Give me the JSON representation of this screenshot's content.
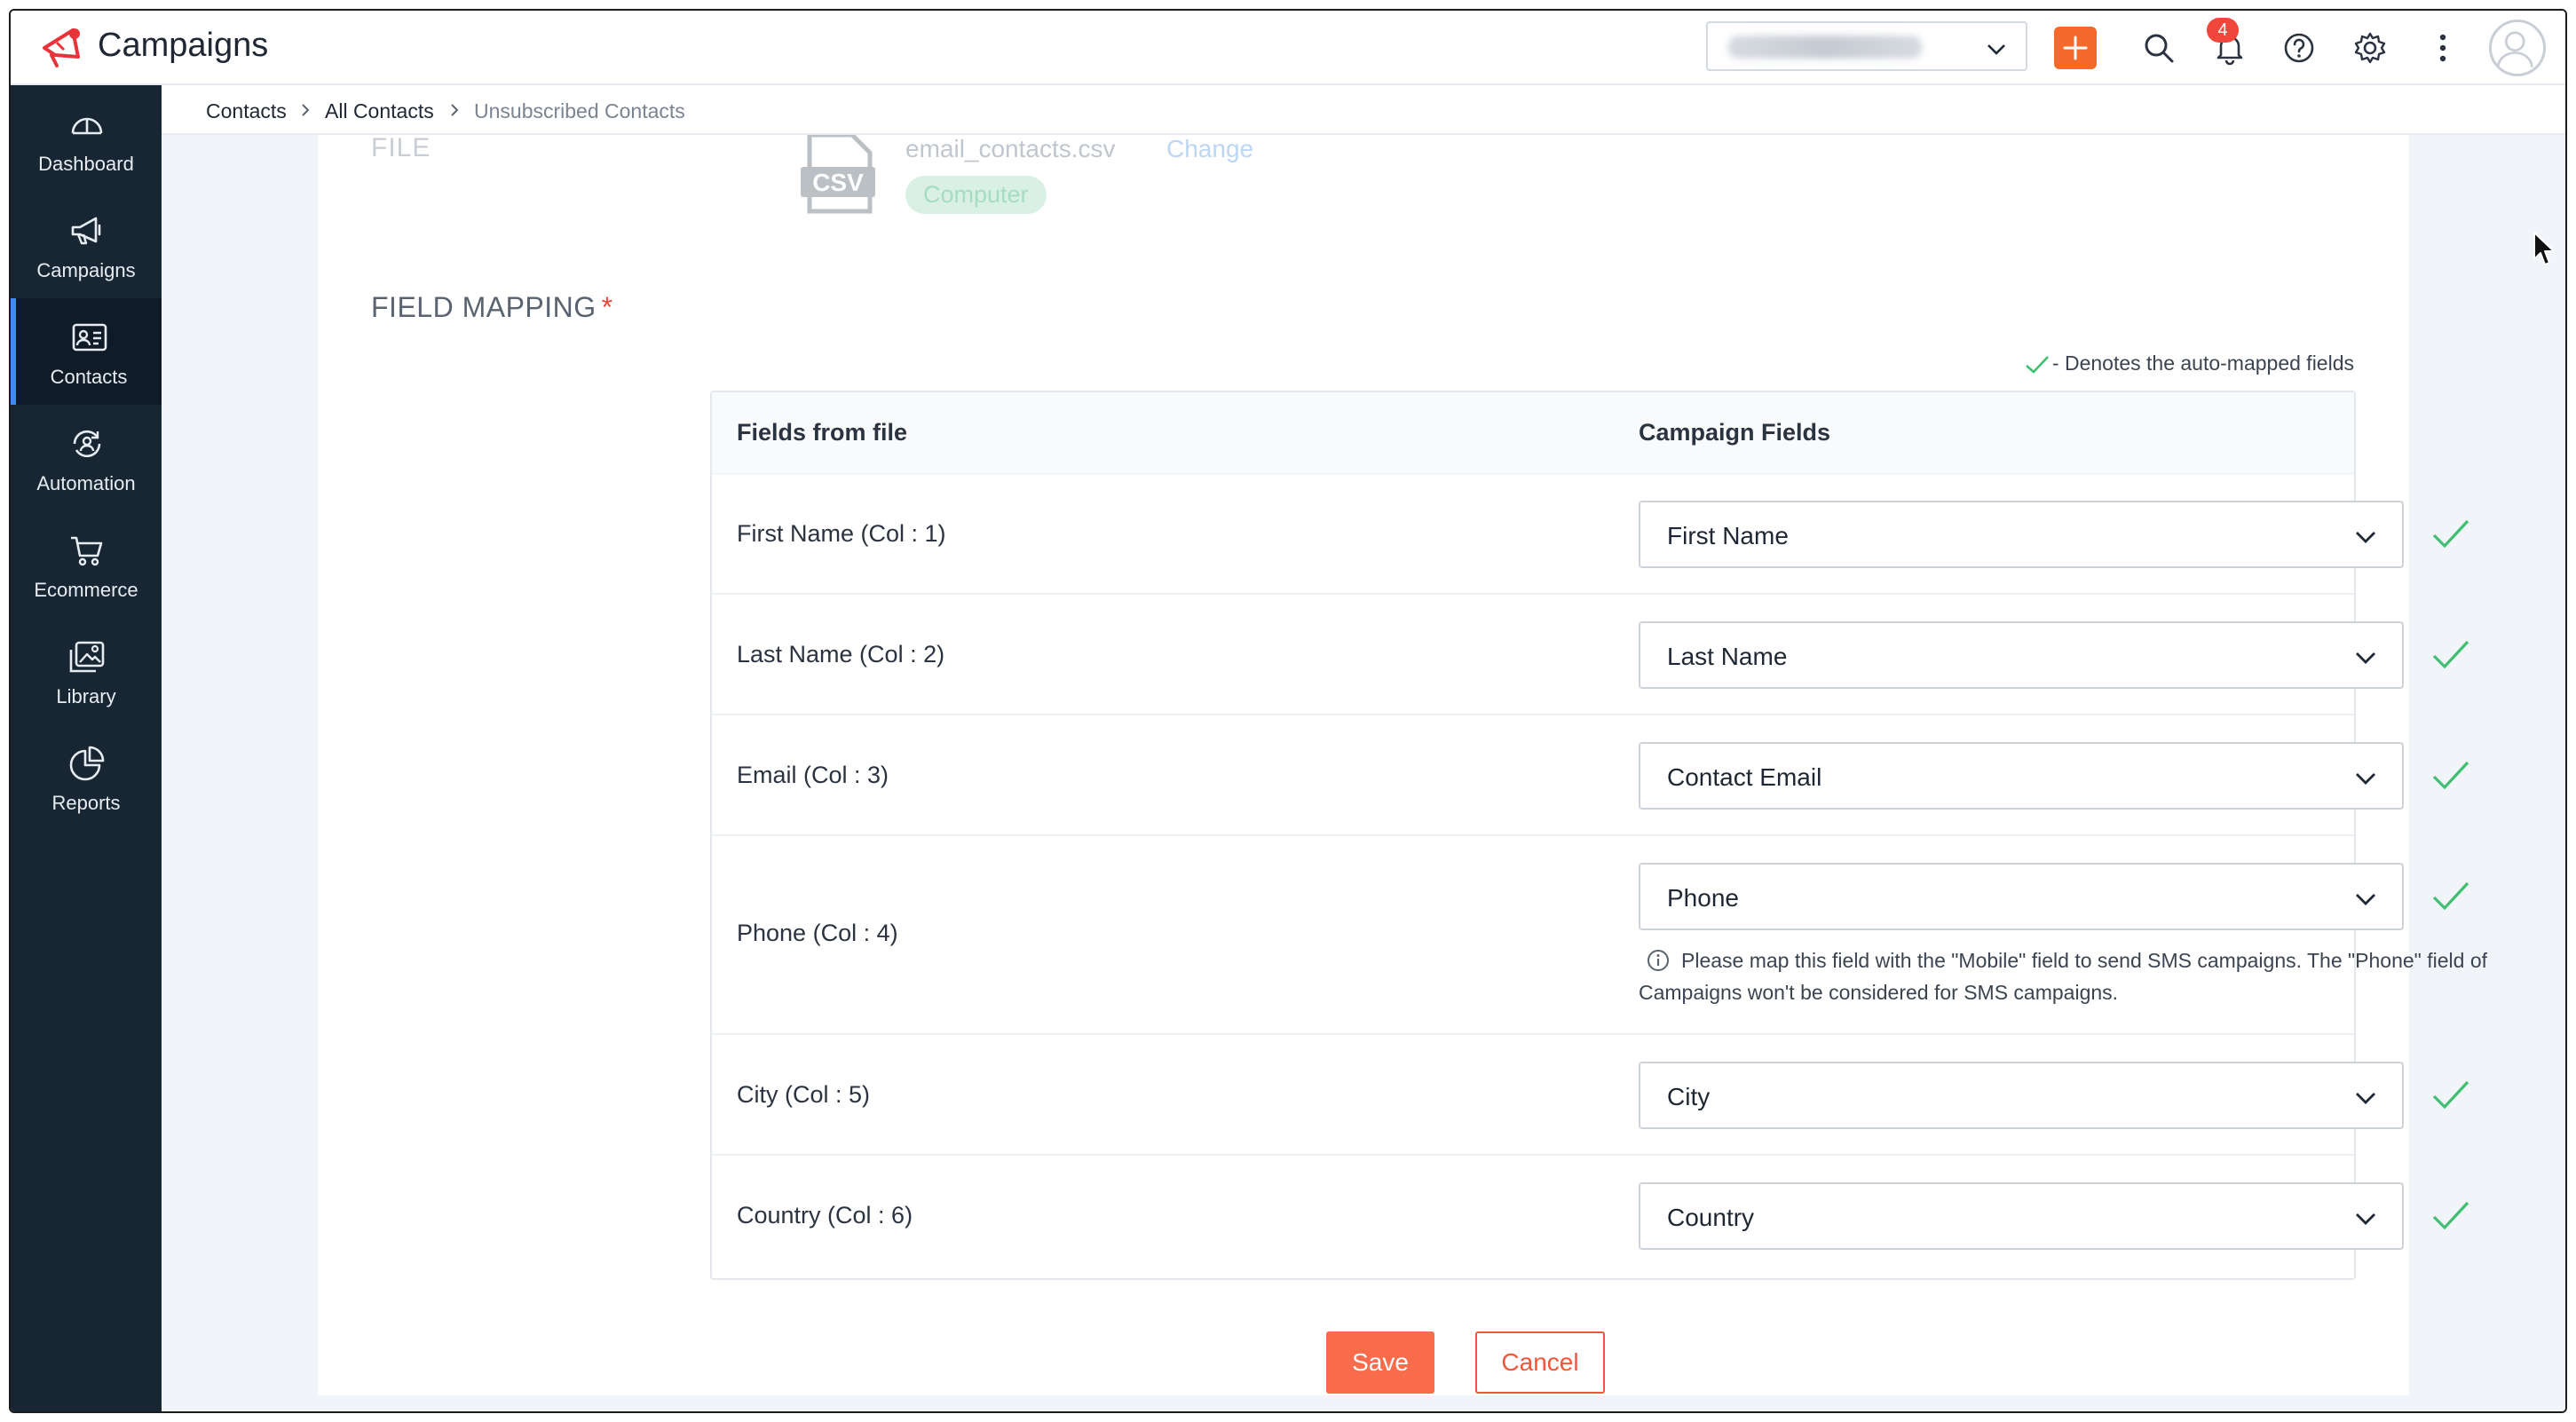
{
  "header": {
    "app_title": "Campaigns",
    "notification_count": "4",
    "icons": [
      "add-icon",
      "search-icon",
      "bell-icon",
      "help-icon",
      "gear-icon",
      "more-vertical-icon",
      "avatar-icon"
    ]
  },
  "sidebar": {
    "items": [
      {
        "label": "Dashboard",
        "icon": "gauge-icon",
        "active": false
      },
      {
        "label": "Campaigns",
        "icon": "megaphone-icon",
        "active": false
      },
      {
        "label": "Contacts",
        "icon": "contact-card-icon",
        "active": true
      },
      {
        "label": "Automation",
        "icon": "automation-icon",
        "active": false
      },
      {
        "label": "Ecommerce",
        "icon": "cart-icon",
        "active": false
      },
      {
        "label": "Library",
        "icon": "image-library-icon",
        "active": false
      },
      {
        "label": "Reports",
        "icon": "pie-chart-icon",
        "active": false
      }
    ]
  },
  "breadcrumb": {
    "items": [
      "Contacts",
      "All Contacts"
    ],
    "current": "Unsubscribed Contacts"
  },
  "file_section": {
    "label": "FILE",
    "file_name": "email_contacts.csv",
    "change_label": "Change",
    "source": "Computer",
    "file_icon_text": "CSV"
  },
  "field_mapping": {
    "title": "FIELD MAPPING",
    "required_mark": "*",
    "legend_text": "- Denotes the auto-mapped fields",
    "columns": [
      "Fields from file",
      "Campaign Fields"
    ],
    "rows": [
      {
        "file_field": "First Name (Col : 1)",
        "campaign_field": "First Name",
        "auto_mapped": true
      },
      {
        "file_field": "Last Name (Col : 2)",
        "campaign_field": "Last Name",
        "auto_mapped": true
      },
      {
        "file_field": "Email (Col : 3)",
        "campaign_field": "Contact Email",
        "auto_mapped": true
      },
      {
        "file_field": "Phone (Col : 4)",
        "campaign_field": "Phone",
        "auto_mapped": true,
        "note": "Please map this field with the \"Mobile\" field to send SMS campaigns. The \"Phone\" field of Campaigns won't be considered for SMS campaigns."
      },
      {
        "file_field": "City (Col : 5)",
        "campaign_field": "City",
        "auto_mapped": true
      },
      {
        "file_field": "Country (Col : 6)",
        "campaign_field": "Country",
        "auto_mapped": true
      }
    ]
  },
  "actions": {
    "save_label": "Save",
    "cancel_label": "Cancel"
  },
  "colors": {
    "accent_orange": "#f5692a",
    "sidebar_bg": "#182634",
    "active_indicator": "#3d8bf0",
    "check_green": "#3fbf6f",
    "chat_blue": "#1f6fd1"
  }
}
